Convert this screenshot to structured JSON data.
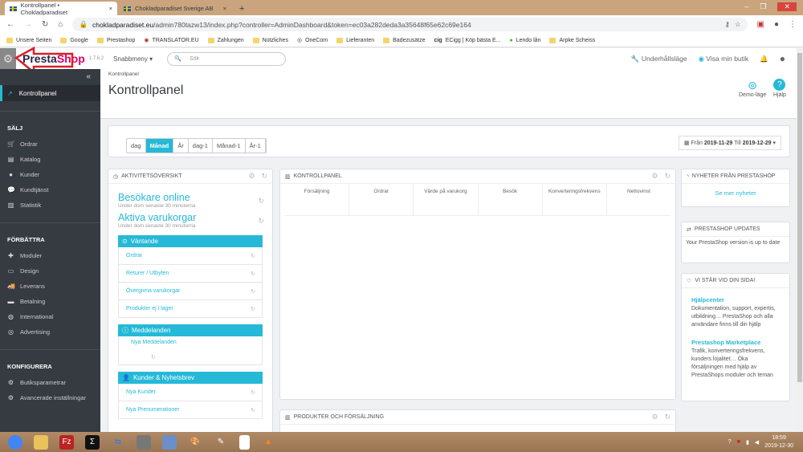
{
  "browser": {
    "tabs": [
      {
        "title": "Kontrollpanel • Chokladparadiset",
        "close": "×"
      },
      {
        "title": "Chokladparadiset Sverige AB",
        "close": "×"
      }
    ],
    "new_tab": "+",
    "url_domain": "chokladparadiset.eu",
    "url_path": "/admin780tazw13/index.php?controller=AdminDashboard&token=ec03a282deda3a35648f65e62c69e164",
    "bookmarks": [
      "Unsere Seiten",
      "Google",
      "Prestashop",
      "TRANSLATOR.EU",
      "Zahlungen",
      "Nützliches",
      "OneCom",
      "Lieferanten",
      "Badezusätze",
      "ECigg | Köp bästa E...",
      "Lendo lån",
      "Arpke Scheiss"
    ]
  },
  "header": {
    "logo": "PrestaShop",
    "version": "1.7.6.2",
    "quick_menu": "Snabbmeny",
    "search_placeholder": "Sök",
    "maintenance": "Underhållsläge",
    "view_shop": "Visa min butik"
  },
  "sidebar": {
    "collapse": "«",
    "active": "Kontrollpanel",
    "sections": [
      {
        "title": "SÄLJ",
        "items": [
          [
            "Ordrar",
            "🛒"
          ],
          [
            "Katalog",
            "▤"
          ],
          [
            "Kunder",
            "●"
          ],
          [
            "Kundtjänst",
            "💬"
          ],
          [
            "Statistik",
            "▥"
          ]
        ]
      },
      {
        "title": "FÖRBÄTTRA",
        "items": [
          [
            "Moduler",
            "✚"
          ],
          [
            "Design",
            "▭"
          ],
          [
            "Leverans",
            "🚚"
          ],
          [
            "Betalning",
            "▬"
          ],
          [
            "International",
            "◍"
          ],
          [
            "Advertising",
            "◎"
          ]
        ]
      },
      {
        "title": "KONFIGURERA",
        "items": [
          [
            "Butiksparametrar",
            "⚙"
          ],
          [
            "Avancerade inställningar",
            "⚙"
          ]
        ]
      }
    ]
  },
  "page": {
    "breadcrumb": "Kontrollpanel",
    "title": "Kontrollpanel",
    "demo": "Demo-läge",
    "help": "Hjälp"
  },
  "periods": [
    "dag",
    "Månad",
    "År",
    "dag-1",
    "Månad-1",
    "År-1"
  ],
  "date": {
    "from_label": "Från",
    "from": "2019-11-29",
    "to_label": "Till",
    "to": "2019-12-29"
  },
  "activity": {
    "title": "AKTIVITETSÖVERSIKT",
    "online": "Besökare online",
    "online_sub": "Under dom senaste 30 minuterna",
    "carts": "Aktiva varukorgar",
    "carts_sub": "Under dom senaste 30 minuterna",
    "pending": "Väntande",
    "pending_items": [
      "Ordrar",
      "Returer / Utbyten",
      "Övergivna varukorgar",
      "Produkter ej i lager"
    ],
    "messages": "Meddelanden",
    "messages_items": [
      "Nya Meddelanden"
    ],
    "customers": "Kunder & Nyhetsbrev",
    "customers_items": [
      "Nya Kunder",
      "Nya Prenumerationer"
    ]
  },
  "dashboard": {
    "title": "KONTROLLPANEL",
    "columns": [
      "Försäljning",
      "Ordrar",
      "Värde på varukorg",
      "Besök",
      "Konverteringsfrekvens",
      "Nettovinst"
    ]
  },
  "products": {
    "title": "PRODUKTER OCH FÖRSÄLJNING"
  },
  "news": {
    "title": "NYHETER FRÅN PRESTASHOP",
    "link": "Se mer nyheter"
  },
  "updates": {
    "title": "PRESTASHOP UPDATES",
    "text": "Your PrestaShop version is up to date"
  },
  "help": {
    "title": "VI STÄR VID DIN SIDA!",
    "items": [
      {
        "title": "Hjälpcenter",
        "text": "Dokumentation, support, expertis, utbildning… PrestaShop och alla användare finns till din hjälp"
      },
      {
        "title": "Prestashop Marketplace",
        "text": "Trafik, konverteringsfrekvens, kunders lojalitet… Öka försäljningen med hjälp av PrestaShops moduler och teman"
      }
    ]
  },
  "taskbar": {
    "time": "18:59",
    "date": "2019-12-30"
  }
}
